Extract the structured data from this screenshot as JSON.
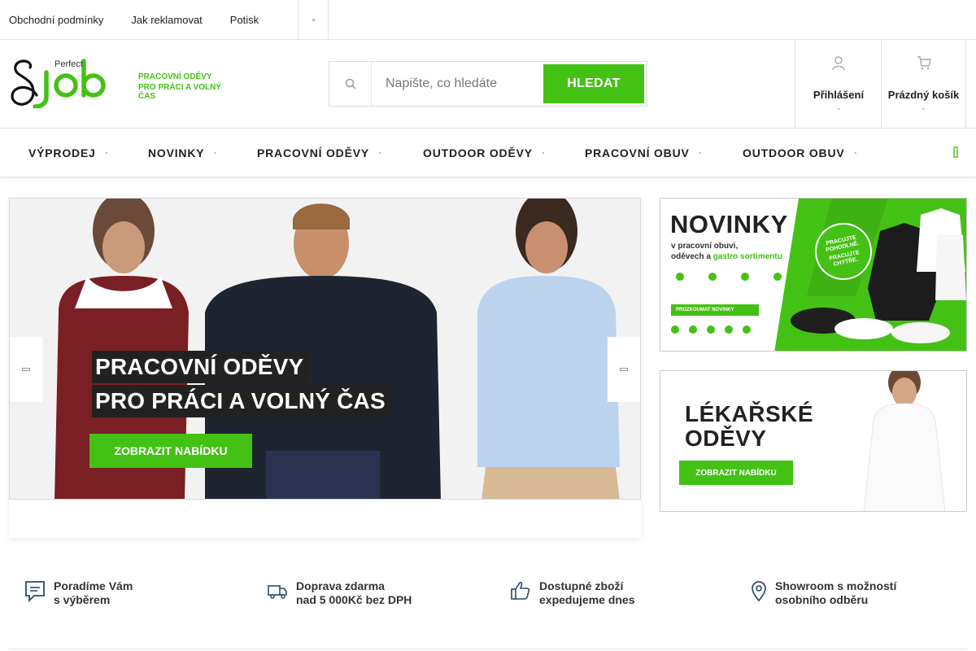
{
  "topbar": {
    "links": [
      "Obchodní podmínky",
      "Jak reklamovat",
      "Potisk"
    ],
    "more_glyph": ""
  },
  "logo": {
    "brand_small": "Perfect",
    "brand_big": "job",
    "tagline_1": "PRACOVNÍ ODĚVY",
    "tagline_2": "PRO PRÁCI A VOLNÝ ČAS"
  },
  "search": {
    "placeholder": "Napište, co hledáte",
    "button_label": "HLEDAT",
    "icon": "search-icon"
  },
  "account": {
    "label": "Přihlášení",
    "icon": "user-icon"
  },
  "cart": {
    "label": "Prázdný košík",
    "icon": "cart-icon"
  },
  "nav": {
    "items": [
      "VÝPRODEJ",
      "NOVINKY",
      "PRACOVNÍ ODĚVY",
      "OUTDOOR ODĚVY",
      "PRACOVNÍ OBUV",
      "OUTDOOR OBUV"
    ]
  },
  "hero": {
    "line_1": "PRACOVNÍ ODĚVY",
    "line_2": "PRO PRÁCI A VOLNÝ ČAS",
    "button": "ZOBRAZIT NABÍDKU"
  },
  "banner_new": {
    "title": "NOVINKY",
    "sub_1": "v pracovní obuvi,",
    "sub_2": "oděvech a",
    "sub_2_highlight": "gastro sortimentu",
    "badge_1": "PRACUJTE POHODLNĚ.",
    "badge_2": "PRACUJTE CHYTŘE.",
    "button": "PROZKOUMAT NOVINKY"
  },
  "banner_medical": {
    "title_1": "LÉKAŘSKÉ",
    "title_2": "ODĚVY",
    "button": "ZOBRAZIT NABÍDKU"
  },
  "features": [
    {
      "line_1": "Poradíme Vám",
      "line_2": "s výběrem",
      "icon": "chat-icon"
    },
    {
      "line_1": "Doprava zdarma",
      "line_2": "nad 5 000Kč bez DPH",
      "icon": "truck-icon"
    },
    {
      "line_1": "Dostupné zboží",
      "line_2": "expedujeme dnes",
      "icon": "thumbs-up-icon"
    },
    {
      "line_1": "Showroom s možností",
      "line_2": "osobního odběru",
      "icon": "location-pin-icon"
    }
  ],
  "colors": {
    "accent": "#44c115",
    "text": "#222222",
    "border": "#e2e2e2"
  }
}
